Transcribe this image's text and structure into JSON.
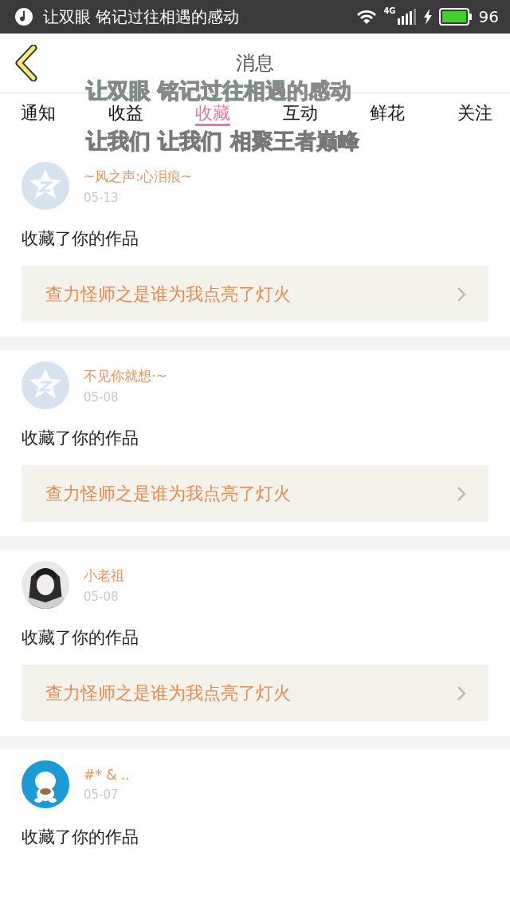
{
  "status_bar": {
    "song_title": "让双眼 铭记过往相遇的感动",
    "network": "4G",
    "battery": "96"
  },
  "header": {
    "title": "消息"
  },
  "tabs": [
    {
      "label": "通知",
      "selected": false
    },
    {
      "label": "收益",
      "selected": false
    },
    {
      "label": "收藏",
      "selected": true
    },
    {
      "label": "互动",
      "selected": false
    },
    {
      "label": "鲜花",
      "selected": false
    },
    {
      "label": "关注",
      "selected": false
    }
  ],
  "lyrics_overlay": {
    "line_1": "让双眼 铭记过往相遇的感动",
    "line_2": "让我们 让我们 相聚王者巅峰"
  },
  "messages": [
    {
      "avatar": {
        "kind": "default"
      },
      "name": "~风之声:心泪痕~",
      "date": "05-13",
      "text": "收藏了你的作品",
      "link": "查力怪师之是谁为我点亮了灯火"
    },
    {
      "avatar": {
        "kind": "default"
      },
      "name": "不见你就想·~",
      "date": "05-08",
      "text": "收藏了你的作品",
      "link": "查力怪师之是谁为我点亮了灯火"
    },
    {
      "name": "小老祖",
      "date": "05-08",
      "text": "收藏了你的作品",
      "link": "查力怪师之是谁为我点亮了灯火"
    },
    {
      "name": "#* & ..",
      "date": "05-07",
      "text": "收藏了你的作品"
    }
  ]
}
